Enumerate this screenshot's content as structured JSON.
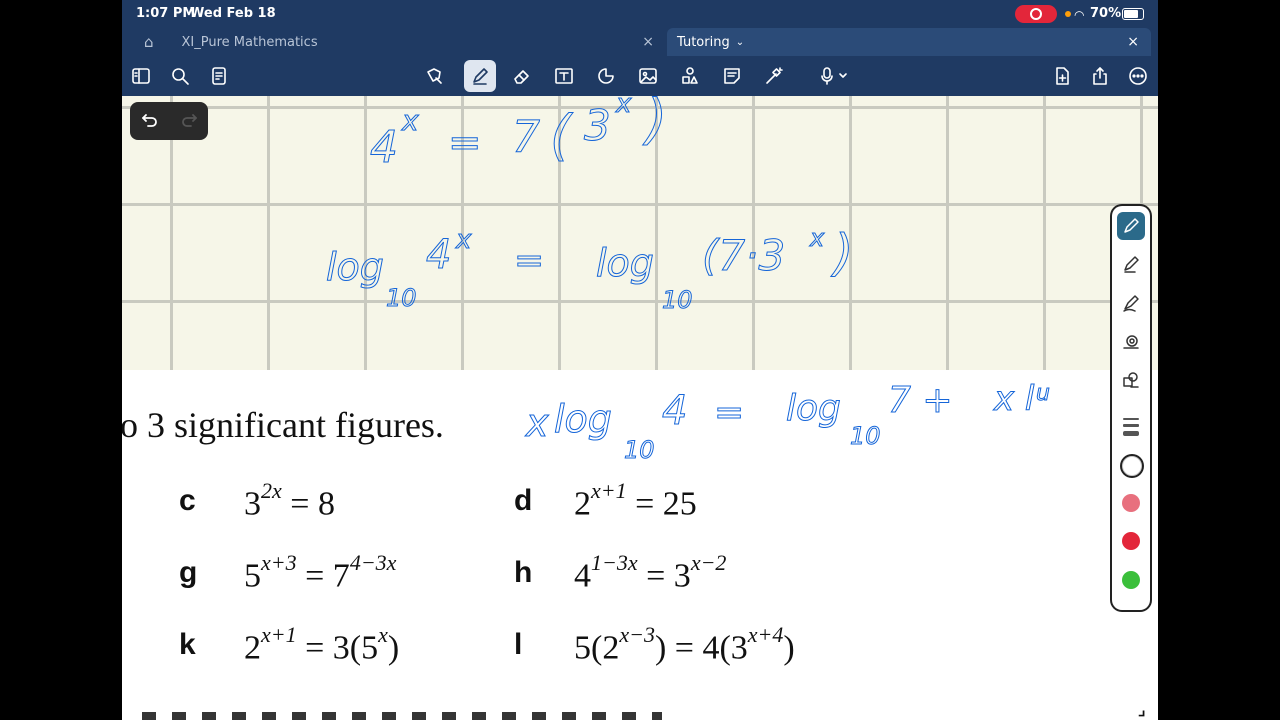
{
  "status_bar": {
    "time": "1:07 PM",
    "date": "Wed Feb 18",
    "battery": "70%"
  },
  "tabs": [
    {
      "label": "XI_Pure Mathematics",
      "active": false
    },
    {
      "label": "Tutoring",
      "active": true
    }
  ],
  "toolbar": {
    "left": [
      "sidebar-icon",
      "search-icon",
      "document-icon"
    ],
    "center": [
      "lasso-icon",
      "pen-icon",
      "eraser-icon",
      "textbox-icon",
      "shapes-icon",
      "image-icon",
      "elements-icon",
      "sticky-note-icon",
      "laser-icon",
      "audio-icon"
    ],
    "right": [
      "add-page-icon",
      "share-icon",
      "more-icon"
    ]
  },
  "document": {
    "instruction": "o 3 significant figures.",
    "questions": [
      {
        "label": "c",
        "base": "3",
        "exp": "2x",
        "rhs": "= 8"
      },
      {
        "label": "d",
        "base": "2",
        "exp": "x+1",
        "rhs": "= 25"
      },
      {
        "label": "g",
        "base": "5",
        "exp": "x+3",
        "rhs": "= 7",
        "rhs_exp": "4−3x"
      },
      {
        "label": "h",
        "base": "4",
        "exp": "1−3x",
        "rhs": "= 3",
        "rhs_exp": "x−2"
      },
      {
        "label": "k",
        "base": "2",
        "exp": "x+1",
        "rhs": "= 3(5",
        "rhs_exp": "x",
        "rhs_tail": ")"
      },
      {
        "label": "l",
        "base": "5(2",
        "exp": "x−3",
        "rhs": ") = 4(3",
        "rhs_exp": "x+4",
        "rhs_tail": ")"
      }
    ]
  },
  "handwriting": {
    "line1": {
      "a": "4",
      "a_exp": "x",
      "eq": "=",
      "b": "7",
      "paren": "(",
      "c": "3",
      "c_exp": "x",
      "close": ")"
    },
    "line2": {
      "log": "log",
      "sub": "10",
      "a": "4",
      "a_exp": "x",
      "eq": "=",
      "log2": "log",
      "sub2": "10",
      "rhs": "(7·3",
      "rhs_exp": "x",
      "close": ")"
    },
    "line3": {
      "x": "x",
      "log": "log",
      "sub": "10",
      "a": "4",
      "eq": "=",
      "log2": "log",
      "sub2": "10",
      "b": "7 +",
      "tail": "x l",
      "tail2": "u"
    }
  },
  "colors": {
    "pen": "#1565d8",
    "toolbar": "#1f3a63",
    "grid_bg": "#f6f6e8",
    "swatch_white": "#ffffff",
    "swatch_pink": "#e8707e",
    "swatch_red": "#e3263a",
    "swatch_green": "#3bbf3b"
  }
}
